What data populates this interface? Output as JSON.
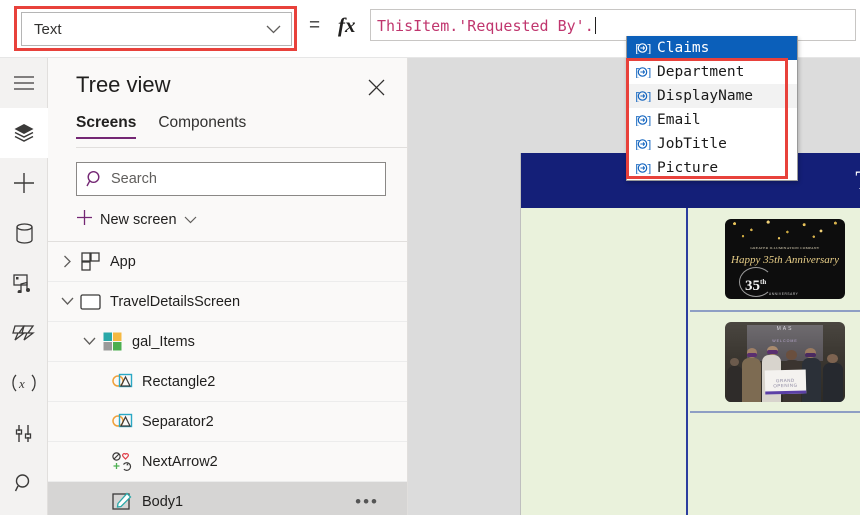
{
  "topbar": {
    "property_dropdown": {
      "selected": "Text",
      "chevron_icon": "chevron-down-icon",
      "highlighted": true
    },
    "equals_symbol": "=",
    "fx_symbol": "fx",
    "formula": {
      "value": "ThisItem.'Requested By'.",
      "caret_visible": true
    }
  },
  "intellisense": {
    "items": [
      {
        "label": "Claims",
        "icon": "record-field-icon",
        "selected": true
      },
      {
        "label": "Department",
        "icon": "record-field-icon",
        "selected": false
      },
      {
        "label": "DisplayName",
        "icon": "record-field-icon",
        "selected": false
      },
      {
        "label": "Email",
        "icon": "record-field-icon",
        "selected": false
      },
      {
        "label": "JobTitle",
        "icon": "record-field-icon",
        "selected": false
      },
      {
        "label": "Picture",
        "icon": "record-field-icon",
        "selected": false
      }
    ],
    "selected_color": "#0b5fba",
    "highlight_box_color": "#e8413b"
  },
  "rail": {
    "items": [
      {
        "name": "hamburger-menu",
        "icon": "hamburger-icon",
        "active": false
      },
      {
        "name": "tree-view",
        "icon": "layers-icon",
        "active": true
      },
      {
        "name": "insert",
        "icon": "plus-icon",
        "active": false
      },
      {
        "name": "data",
        "icon": "database-icon",
        "active": false
      },
      {
        "name": "media",
        "icon": "media-icon",
        "active": false
      },
      {
        "name": "power-automate",
        "icon": "power-automate-icon",
        "active": false
      },
      {
        "name": "variables",
        "icon": "variables-x-icon",
        "active": false
      },
      {
        "name": "advanced-tools",
        "icon": "tools-icon",
        "active": false
      },
      {
        "name": "search",
        "icon": "search-icon",
        "active": false
      }
    ]
  },
  "tree_panel": {
    "title": "Tree view",
    "close_icon": "close-icon",
    "tabs": [
      {
        "label": "Screens",
        "active": true
      },
      {
        "label": "Components",
        "active": false
      }
    ],
    "search": {
      "placeholder": "Search",
      "value": "",
      "icon": "search-icon"
    },
    "new_screen": {
      "label": "New screen",
      "plus_icon": "plus-icon",
      "chevron_icon": "chevron-down-icon"
    },
    "items": [
      {
        "label": "App",
        "icon": "app-icon",
        "indent": 0,
        "expander": "collapsed",
        "selected": false,
        "more": false
      },
      {
        "label": "TravelDetailsScreen",
        "icon": "screen-icon",
        "indent": 0,
        "expander": "expanded",
        "selected": false,
        "more": false
      },
      {
        "label": "gal_Items",
        "icon": "gallery-icon",
        "indent": 1,
        "expander": "expanded",
        "selected": false,
        "more": false
      },
      {
        "label": "Rectangle2",
        "icon": "shape-icon",
        "indent": 2,
        "expander": "none",
        "selected": false,
        "more": false
      },
      {
        "label": "Separator2",
        "icon": "shape-icon",
        "indent": 2,
        "expander": "none",
        "selected": false,
        "more": false
      },
      {
        "label": "NextArrow2",
        "icon": "icon-shape-icon",
        "indent": 2,
        "expander": "none",
        "selected": false,
        "more": false
      },
      {
        "label": "Body1",
        "icon": "label-icon",
        "indent": 2,
        "expander": "none",
        "selected": true,
        "more": true,
        "more_label": "•••"
      }
    ]
  },
  "canvas": {
    "background_color": "#dcdcdc",
    "app_screen": {
      "header": {
        "background_color": "#141f78",
        "title": "Tr"
      },
      "body_color": "#eaf2dc",
      "gallery": {
        "separator_color": "#2c3e9e",
        "row_divider_color": "#8f9fc4",
        "cells": [
          {
            "type": "image-card",
            "content": "anniversary-card",
            "company": "GREATER ILLUMINATION COMPANY",
            "headline": "Happy 35th Anniversary",
            "badge": "35",
            "badge_sup": "th",
            "badge_sub": "ANNIVERSARY"
          },
          {
            "type": "image-card",
            "content": "team-photo",
            "overlay_title": "MAS",
            "overlay_sub": "WELCOME",
            "banner_text": "GRAND OPENING"
          },
          {
            "type": "empty-cell",
            "content": ""
          }
        ]
      }
    }
  }
}
